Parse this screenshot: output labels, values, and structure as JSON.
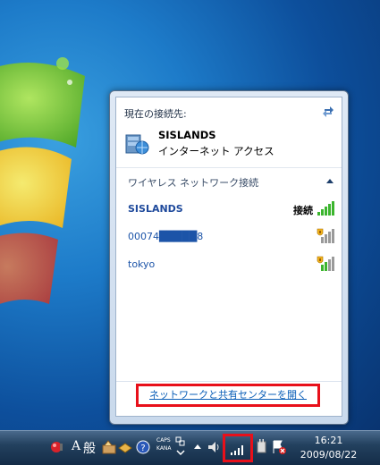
{
  "popup": {
    "current_connection_label": "現在の接続先:",
    "current_network": {
      "name": "SISLANDS",
      "access": "インターネット アクセス"
    },
    "section_title": "ワイヤレス ネットワーク接続",
    "networks": [
      {
        "ssid": "SISLANDS",
        "status": "接続",
        "secured": false,
        "active": true
      },
      {
        "ssid": "00074█████8",
        "status": "",
        "secured": true,
        "active": false
      },
      {
        "ssid": "tokyo",
        "status": "",
        "secured": true,
        "active": false
      }
    ],
    "open_center_link": "ネットワークと共有センターを開く"
  },
  "taskbar": {
    "ime_a": "A",
    "ime_mode": "般",
    "caps_label": "CAPS",
    "kana_label": "KANA",
    "time": "16:21",
    "date": "2009/08/22"
  },
  "colors": {
    "link": "#0b5fb8",
    "highlight": "#e8101a",
    "signal": "#3cb52e"
  }
}
